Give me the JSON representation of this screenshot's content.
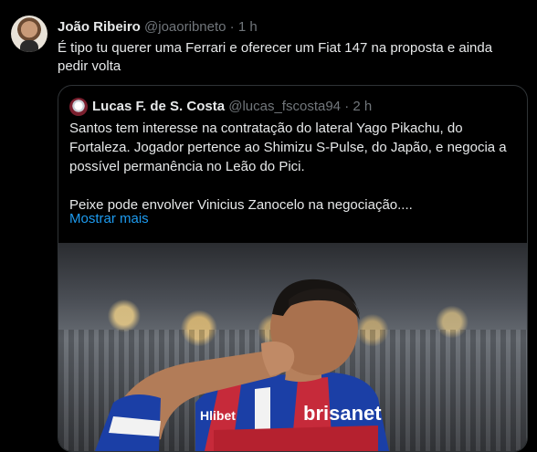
{
  "author": {
    "name": "João Ribeiro",
    "handle": "@joaoribneto",
    "separator": "·",
    "time": "1 h",
    "text": "É tipo tu querer uma Ferrari e oferecer um Fiat 147 na proposta e ainda pedir volta"
  },
  "quoted": {
    "name": "Lucas F. de S. Costa",
    "handle": "@lucas_fscosta94",
    "separator": "·",
    "time": "2 h",
    "paragraph1": "Santos tem interesse na contratação do lateral Yago Pikachu, do Fortaleza. Jogador pertence ao Shimizu S-Pulse, do Japão, e negocia a possível permanência no Leão do Pici.",
    "paragraph2": "Peixe pode envolver Vinicius Zanocelo na negociação....",
    "show_more": "Mostrar mais",
    "photo_text_1": "Hlibet",
    "photo_text_2": "brisanet"
  }
}
